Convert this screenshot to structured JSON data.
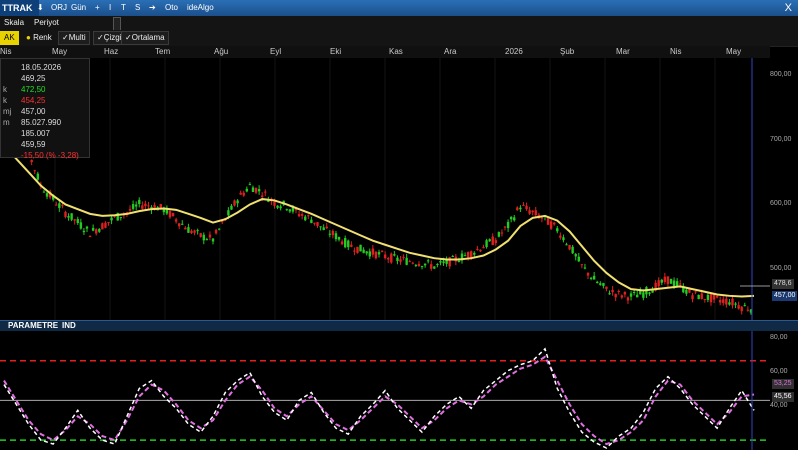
{
  "toolbar": {
    "symbol": "TTRAK",
    "items": [
      "ORJ",
      "Gün",
      "+",
      "I",
      "T",
      "S",
      "➔",
      "Oto",
      "ideAlgo"
    ],
    "close": "X"
  },
  "menu": {
    "scale": "Skala",
    "period": "Periyot"
  },
  "options": {
    "ak": "AK",
    "renk": "Renk",
    "multi": "Multi",
    "cizgi": "Çizgi",
    "ortalama": "Ortalama"
  },
  "months": [
    "Nis",
    "May",
    "Haz",
    "Tem",
    "Ağu",
    "Eyl",
    "Eki",
    "Kas",
    "Ara",
    "2026",
    "Şub",
    "Mar",
    "Nis",
    "May"
  ],
  "info": {
    "date": "18.05.2026",
    "open": "469,25",
    "high": "472,50",
    "low": "454,25",
    "close": "457,00",
    "volume": "85.027.990",
    "lots": "185.007",
    "avg": "459,59",
    "change": "-15,50 (% -3,28)",
    "row_labels": [
      "k",
      "k",
      "mj",
      "m"
    ]
  },
  "price_axis": [
    "800,00",
    "700,00",
    "600,00",
    "500,00"
  ],
  "price_tags": {
    "last": "457,00",
    "prev": "478,6"
  },
  "indicator": {
    "header": [
      "PARAMETRE",
      "IND"
    ],
    "axis": [
      "80,00",
      "60,00",
      "40,00"
    ],
    "tags": {
      "val1": "53,25",
      "val2": "45,56"
    }
  },
  "colors": {
    "up": "#22cc22",
    "down": "#e02020",
    "ma": "#f0e070",
    "ind1": "#e070e0",
    "ind2": "#ffffff",
    "overbought": "#e02020",
    "oversold": "#22cc22"
  },
  "chart_data": {
    "type": "line",
    "series": [
      {
        "values": [
          760,
          730,
          690,
          640,
          620,
          600,
          585,
          570,
          580,
          592,
          600,
          612,
          610,
          605,
          590,
          575,
          565,
          560,
          590,
          620,
          640,
          630,
          615,
          610,
          598,
          590,
          575,
          565,
          552,
          545,
          540,
          535,
          530,
          528,
          525,
          520,
          525,
          532,
          540,
          550,
          560,
          580,
          610,
          600,
          590,
          575,
          550,
          520,
          500,
          485,
          478,
          475,
          480,
          490,
          500,
          490,
          478,
          474,
          470,
          468,
          460,
          457
        ]
      },
      {
        "values": [
          700,
          680,
          660,
          640,
          625,
          612,
          605,
          598,
          595,
          596,
          598,
          602,
          605,
          606,
          604,
          598,
          592,
          585,
          590,
          600,
          612,
          620,
          618,
          612,
          605,
          598,
          590,
          582,
          574,
          566,
          558,
          552,
          546,
          540,
          536,
          532,
          530,
          530,
          532,
          536,
          545,
          558,
          580,
          592,
          595,
          588,
          572,
          550,
          528,
          510,
          496,
          486,
          484,
          486,
          488,
          490,
          486,
          482,
          478,
          476,
          475,
          476
        ]
      }
    ],
    "ylim": [
      440,
      830
    ]
  },
  "indicator_data": {
    "type": "line",
    "series": [
      {
        "values": [
          60,
          50,
          40,
          33,
          30,
          35,
          42,
          38,
          32,
          30,
          40,
          52,
          58,
          55,
          48,
          40,
          36,
          40,
          50,
          58,
          62,
          55,
          46,
          42,
          48,
          52,
          45,
          38,
          35,
          40,
          46,
          52,
          48,
          42,
          36,
          40,
          46,
          50,
          48,
          52,
          58,
          62,
          66,
          68,
          72,
          60,
          48,
          38,
          32,
          28,
          30,
          34,
          40,
          52,
          60,
          58,
          50,
          44,
          38,
          44,
          52,
          53
        ]
      },
      {
        "values": [
          58,
          48,
          38,
          30,
          28,
          36,
          45,
          36,
          30,
          28,
          42,
          56,
          60,
          52,
          46,
          38,
          34,
          42,
          54,
          60,
          64,
          52,
          44,
          40,
          50,
          54,
          44,
          36,
          33,
          42,
          48,
          55,
          46,
          40,
          34,
          42,
          48,
          52,
          46,
          55,
          60,
          65,
          68,
          70,
          76,
          56,
          44,
          34,
          29,
          26,
          32,
          36,
          44,
          56,
          62,
          56,
          48,
          42,
          36,
          46,
          55,
          45
        ]
      }
    ],
    "ylim": [
      25,
      85
    ],
    "levels": [
      70,
      30,
      50
    ]
  }
}
